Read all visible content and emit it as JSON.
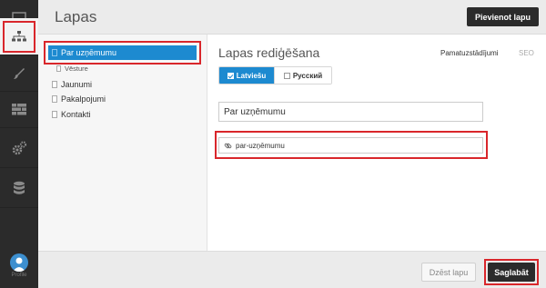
{
  "app": {
    "page_title": "Lapas"
  },
  "header": {
    "add_page_label": "Pievienot lapu"
  },
  "rail": {
    "items": [
      {
        "icon": "monitor-icon"
      },
      {
        "icon": "sitemap-icon",
        "active": true
      },
      {
        "icon": "brush-icon"
      },
      {
        "icon": "grid-icon"
      },
      {
        "icon": "gears-icon"
      },
      {
        "icon": "database-icon"
      }
    ],
    "avatar_icon": "user-avatar-icon",
    "avatar_label": "Profile"
  },
  "tree": {
    "selected": {
      "label": "Par uzņēmumu"
    },
    "child": {
      "label": "Vēsture"
    },
    "items": [
      {
        "label": "Jaunumi"
      },
      {
        "label": "Pakalpojumi"
      },
      {
        "label": "Kontakti"
      }
    ]
  },
  "editor": {
    "title": "Lapas rediģēšana",
    "tabs": [
      {
        "label": "Pamatuzstādījumi"
      },
      {
        "label": "SEO"
      }
    ],
    "languages": [
      {
        "label": "Latviešu",
        "checked": true
      },
      {
        "label": "Русский",
        "checked": false
      }
    ],
    "title_field": {
      "value": "Par uzņēmumu"
    },
    "slug_field": {
      "value": "par-uzņēmumu",
      "icon": "link-icon"
    }
  },
  "footer": {
    "delete_label": "Dzēst lapu",
    "save_label": "Saglabāt"
  },
  "colors": {
    "accent": "#1d8ad0",
    "rail_bg": "#2b2b2b",
    "highlight": "#d9262b"
  }
}
